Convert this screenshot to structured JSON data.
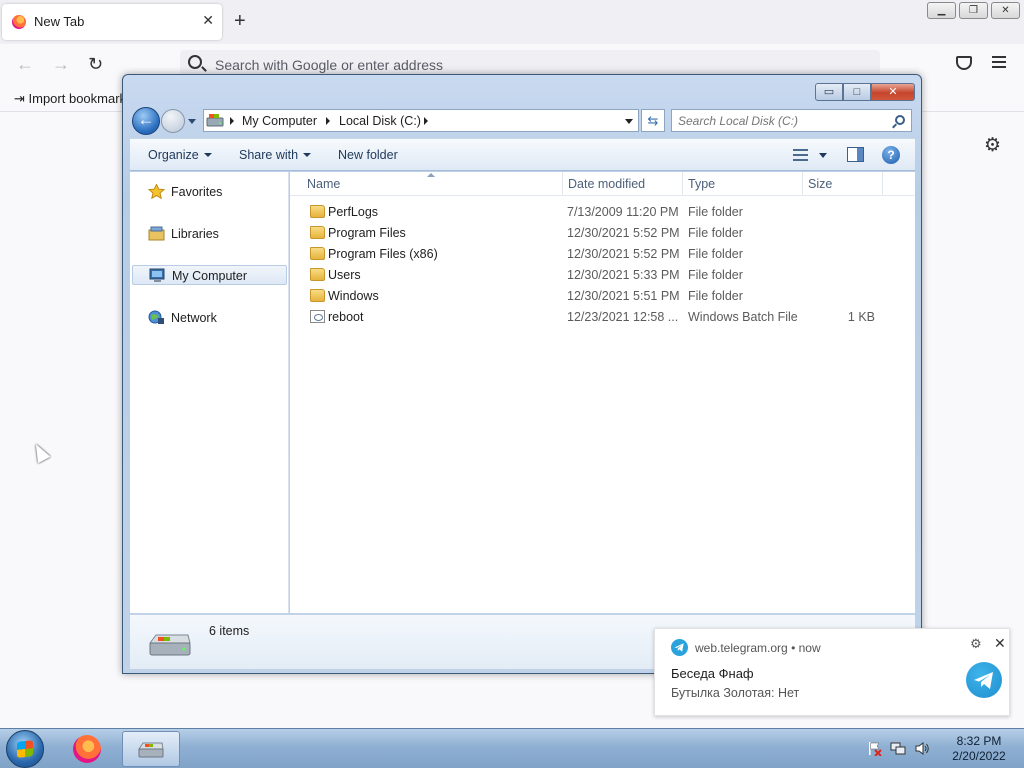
{
  "browser": {
    "tab_title": "New Tab",
    "tab_close": "✕",
    "new_tab": "+",
    "url_placeholder": "Search with Google or enter address",
    "back": "←",
    "forward": "→",
    "reload": "↻",
    "bookmark_import": "⇥ Import bookmarks...",
    "win_min": "▁",
    "win_restore": "❐",
    "win_close": "✕",
    "settings_icon": "⚙"
  },
  "explorer": {
    "win_min": "▭",
    "win_max": "□",
    "win_close": "✕",
    "back": "←",
    "breadcrumb": [
      "My Computer",
      "Local Disk (C:)"
    ],
    "refresh": "⇆",
    "search_placeholder": "Search Local Disk (C:)",
    "toolbar": {
      "organize": "Organize",
      "share_with": "Share with",
      "new_folder": "New folder",
      "help": "?"
    },
    "nav": [
      {
        "label": "Favorites",
        "icon": "star-icon"
      },
      {
        "label": "Libraries",
        "icon": "libraries-icon"
      },
      {
        "label": "My Computer",
        "icon": "computer-icon",
        "selected": true
      },
      {
        "label": "Network",
        "icon": "network-icon"
      }
    ],
    "columns": [
      "Name",
      "Date modified",
      "Type",
      "Size"
    ],
    "files": [
      {
        "name": "PerfLogs",
        "date": "7/13/2009 11:20 PM",
        "type": "File folder",
        "size": "",
        "icon": "folder-icon"
      },
      {
        "name": "Program Files",
        "date": "12/30/2021 5:52 PM",
        "type": "File folder",
        "size": "",
        "icon": "folder-icon"
      },
      {
        "name": "Program Files (x86)",
        "date": "12/30/2021 5:52 PM",
        "type": "File folder",
        "size": "",
        "icon": "folder-icon"
      },
      {
        "name": "Users",
        "date": "12/30/2021 5:33 PM",
        "type": "File folder",
        "size": "",
        "icon": "folder-icon"
      },
      {
        "name": "Windows",
        "date": "12/30/2021 5:51 PM",
        "type": "File folder",
        "size": "",
        "icon": "folder-icon"
      },
      {
        "name": "reboot",
        "date": "12/23/2021 12:58 ...",
        "type": "Windows Batch File",
        "size": "1 KB",
        "icon": "batch-file-icon"
      }
    ],
    "status": "6 items"
  },
  "notification": {
    "origin": "web.telegram.org",
    "time": "now",
    "separator": "•",
    "title": "Беседа Фнаф",
    "body": "Бутылка Золотая: Нет",
    "settings_icon": "⚙",
    "close_icon": "✕"
  },
  "taskbar": {
    "time": "8:32 PM",
    "date": "2/20/2022"
  },
  "colors": {
    "telegram": "#2aa3dd",
    "close_red": "#c5452c",
    "aero_blue": "#b7cde6"
  }
}
